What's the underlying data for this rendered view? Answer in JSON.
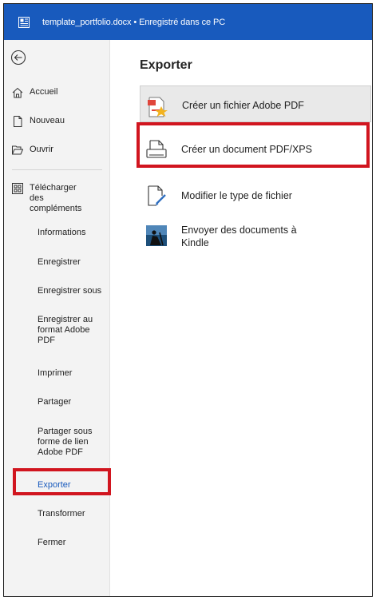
{
  "titlebar": {
    "title": "template_portfolio.docx  •  Enregistré dans ce PC",
    "accent": "#185abd"
  },
  "sidebar": {
    "back_icon": "back-arrow-icon",
    "items": [
      {
        "label": "Accueil",
        "icon": "home-icon"
      },
      {
        "label": "Nouveau",
        "icon": "new-document-icon"
      },
      {
        "label": "Ouvrir",
        "icon": "folder-icon"
      },
      {
        "label": "Télécharger des compléments",
        "icon": "addins-icon"
      },
      {
        "label": "Informations"
      },
      {
        "label": "Enregistrer"
      },
      {
        "label": "Enregistrer sous"
      },
      {
        "label": "Enregistrer au format Adobe PDF"
      },
      {
        "label": "Imprimer"
      },
      {
        "label": "Partager"
      },
      {
        "label": "Partager sous forme de lien Adobe PDF"
      },
      {
        "label": "Exporter",
        "active": true
      },
      {
        "label": "Transformer"
      },
      {
        "label": "Fermer"
      }
    ]
  },
  "main": {
    "heading": "Exporter",
    "options": [
      {
        "label": "Créer un fichier Adobe PDF",
        "icon": "adobe-pdf-icon",
        "selected": true
      },
      {
        "label": "Créer un document PDF/XPS",
        "icon": "pdf-xps-document-icon"
      },
      {
        "label": "Modifier le type de fichier",
        "icon": "change-file-type-icon"
      },
      {
        "label": "Envoyer des documents à Kindle",
        "icon": "kindle-icon"
      }
    ]
  },
  "highlight_color": "#d1151f"
}
